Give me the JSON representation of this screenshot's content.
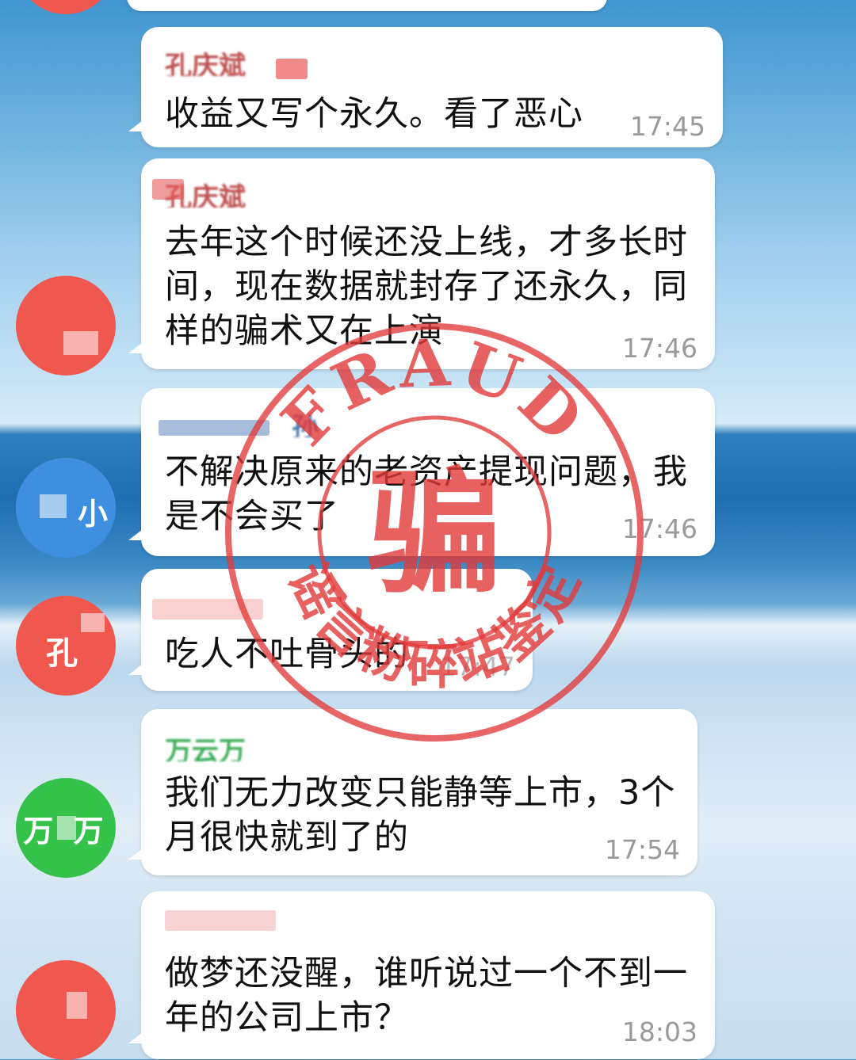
{
  "messages": [
    {
      "sender": "孔庆斌",
      "text": "收益又写个永久。看了恶心",
      "time": "17:45"
    },
    {
      "sender": "孔庆斌",
      "text": "去年这个时候还没上线，才多长时间，现在数据就封存了还永久，同样的骗术又在上演",
      "time": "17:46"
    },
    {
      "sender": "孙",
      "avatar_text": "小",
      "text": "不解决原来的老资产提现问题，我是不会买了",
      "time": "17:46"
    },
    {
      "sender": "",
      "avatar_text": "孔",
      "text": "吃人不吐骨头的",
      "time": "17:47"
    },
    {
      "sender": "万云万",
      "avatar_text": "万 万",
      "text": "我们无力改变只能静等上市，3个月很快就到了的",
      "time": "17:54"
    },
    {
      "sender": "",
      "text": "做梦还没醒，谁听说过一个不到一年的公司上市？",
      "time": "18:03"
    }
  ],
  "stamp": {
    "top_text": "FRAUD",
    "center_text": "骗",
    "bottom_text": "谣言粉碎站鉴定",
    "color": "#e23a3a"
  },
  "colors": {
    "avatar_red": "#f0584f",
    "avatar_blue": "#3f8fe0",
    "avatar_green": "#35c24a"
  }
}
